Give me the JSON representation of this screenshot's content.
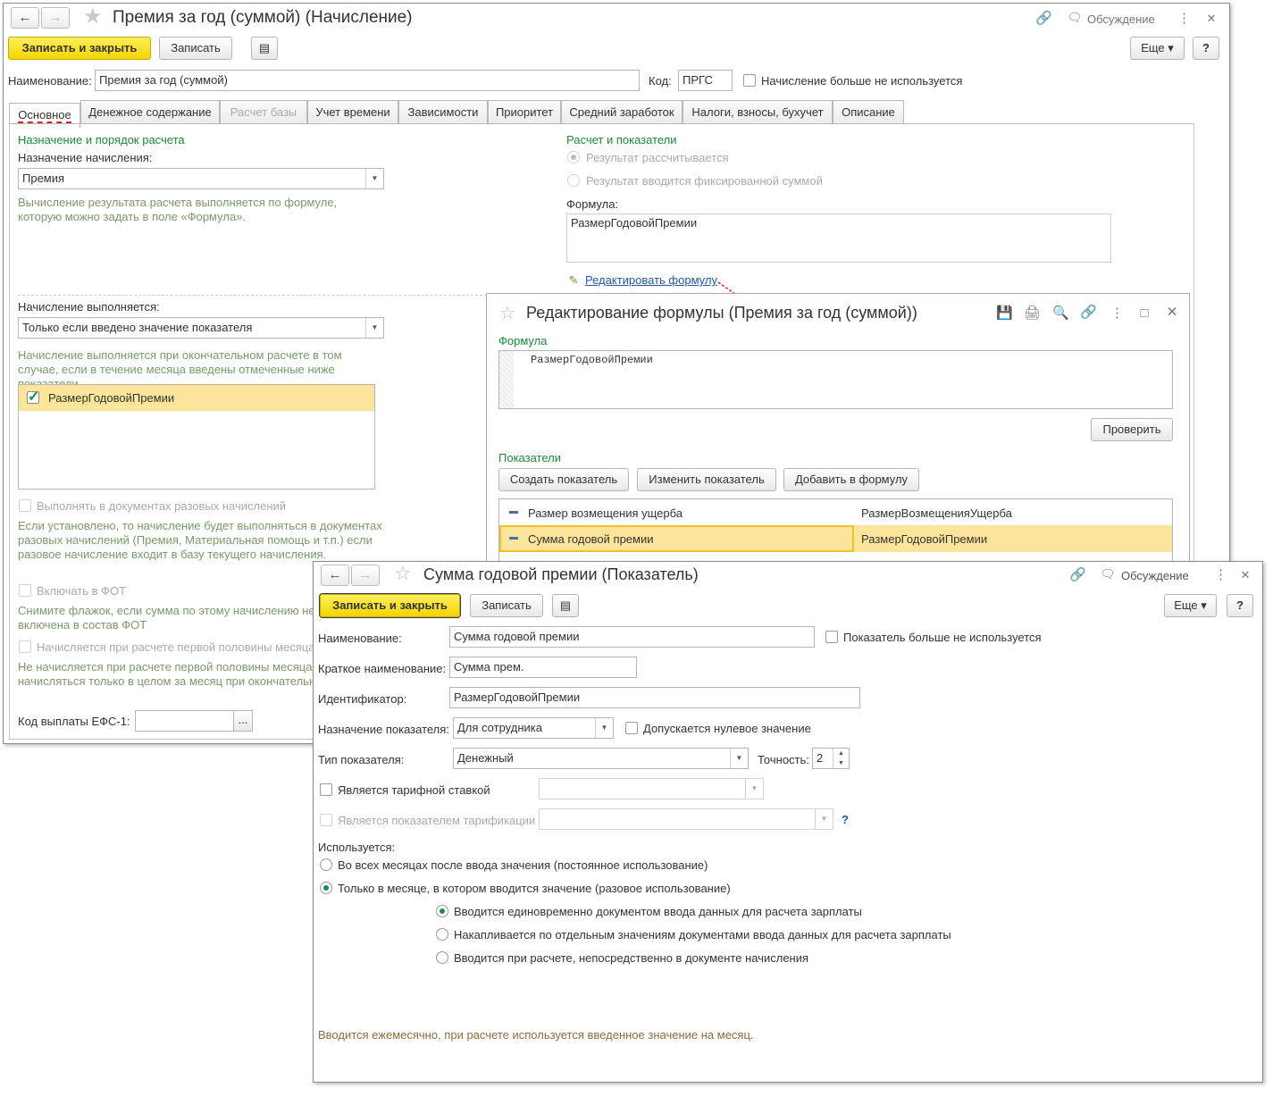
{
  "main": {
    "title": "Премия за год (суммой) (Начисление)",
    "discussion": "Обсуждение",
    "save_close": "Записать и закрыть",
    "save": "Записать",
    "more": "Еще",
    "help": "?",
    "name_label": "Наименование:",
    "name_value": "Премия за год (суммой)",
    "code_label": "Код:",
    "code_value": "ПРГС",
    "not_used_label": "Начисление больше не используется",
    "tabs": [
      "Основное",
      "Денежное содержание",
      "Расчет базы",
      "Учет времени",
      "Зависимости",
      "Приоритет",
      "Средний заработок",
      "Налоги, взносы, бухучет",
      "Описание"
    ],
    "purpose_section": "Назначение и порядок расчета",
    "purpose_label": "Назначение начисления:",
    "purpose_value": "Премия",
    "purpose_note": "Вычисление результата расчета выполняется по формуле, которую можно задать в поле «Формула».",
    "calc_section": "Расчет и показатели",
    "result_calc": "Результат рассчитывается",
    "result_fixed": "Результат вводится фиксированной суммой",
    "formula_label": "Формула:",
    "formula_value": "РазмерГодовойПремии",
    "edit_formula_link": "Редактировать формулу",
    "performed_label": "Начисление выполняется:",
    "performed_value": "Только если введено значение показателя",
    "performed_note": "Начисление выполняется при окончательном расчете в том случае, если в течение месяца введены отмеченные ниже показатели",
    "indicator_item": "РазмерГодовойПремии",
    "one_time_docs_label": "Выполнять в документах разовых начислений",
    "one_time_docs_note": "Если установлено, то начисление будет выполняться в документах разовых начислений (Премия, Материальная помощь и т.п.) если разовое начисление входит в базу текущего начисления.",
    "fot_label": "Включать в ФОТ",
    "fot_note": "Снимите флажок, если сумма по этому начислению не может быть включена в состав ФОТ",
    "first_half_label": "Начисляется при расчете первой половины месяца",
    "first_half_note": "Не начисляется при расчете первой половины месяца, может начисляться только в целом за месяц при окончательном расчете",
    "efs_label": "Код выплаты ЕФС-1:",
    "efs_btn": "..."
  },
  "formula_dialog": {
    "title": "Редактирование формулы (Премия за год (суммой))",
    "formula_section": "Формула",
    "formula_text": "РазмерГодовойПремии",
    "check_btn": "Проверить",
    "indicators_section": "Показатели",
    "create_btn": "Создать показатель",
    "change_btn": "Изменить показатель",
    "add_btn": "Добавить в формулу",
    "rows": [
      {
        "name": "Размер возмещения ущерба",
        "id": "РазмерВозмещенияУщерба"
      },
      {
        "name": "Сумма годовой премии",
        "id": "РазмерГодовойПремии"
      }
    ]
  },
  "indicator": {
    "title": "Сумма годовой премии (Показатель)",
    "discussion": "Обсуждение",
    "save_close": "Записать и закрыть",
    "save": "Записать",
    "more": "Еще",
    "help": "?",
    "name_label": "Наименование:",
    "name_value": "Сумма годовой премии",
    "not_used_label": "Показатель больше не используется",
    "short_label": "Краткое наименование:",
    "short_value": "Сумма прем.",
    "id_label": "Идентификатор:",
    "id_value": "РазмерГодовойПремии",
    "purpose_label": "Назначение показателя:",
    "purpose_value": "Для сотрудника",
    "zero_label": "Допускается нулевое значение",
    "type_label": "Тип показателя:",
    "type_value": "Денежный",
    "precision_label": "Точность:",
    "precision_value": "2",
    "tariff_label": "Является тарифной ставкой",
    "tariffication_label": "Является показателем тарификации",
    "q_mark": "?",
    "used_label": "Используется:",
    "use_permanent": "Во всех месяцах после ввода значения (постоянное использование)",
    "use_once": "Только в месяце, в котором вводится значение (разовое использование)",
    "sub_once_doc": "Вводится единовременно документом ввода данных для расчета зарплаты",
    "sub_accum": "Накапливается по отдельным значениям документами ввода данных для расчета зарплаты",
    "sub_in_calc": "Вводится при расчете, непосредственно в документе начисления",
    "footer_note": "Вводится ежемесячно, при расчете используется введенное значение на месяц."
  }
}
